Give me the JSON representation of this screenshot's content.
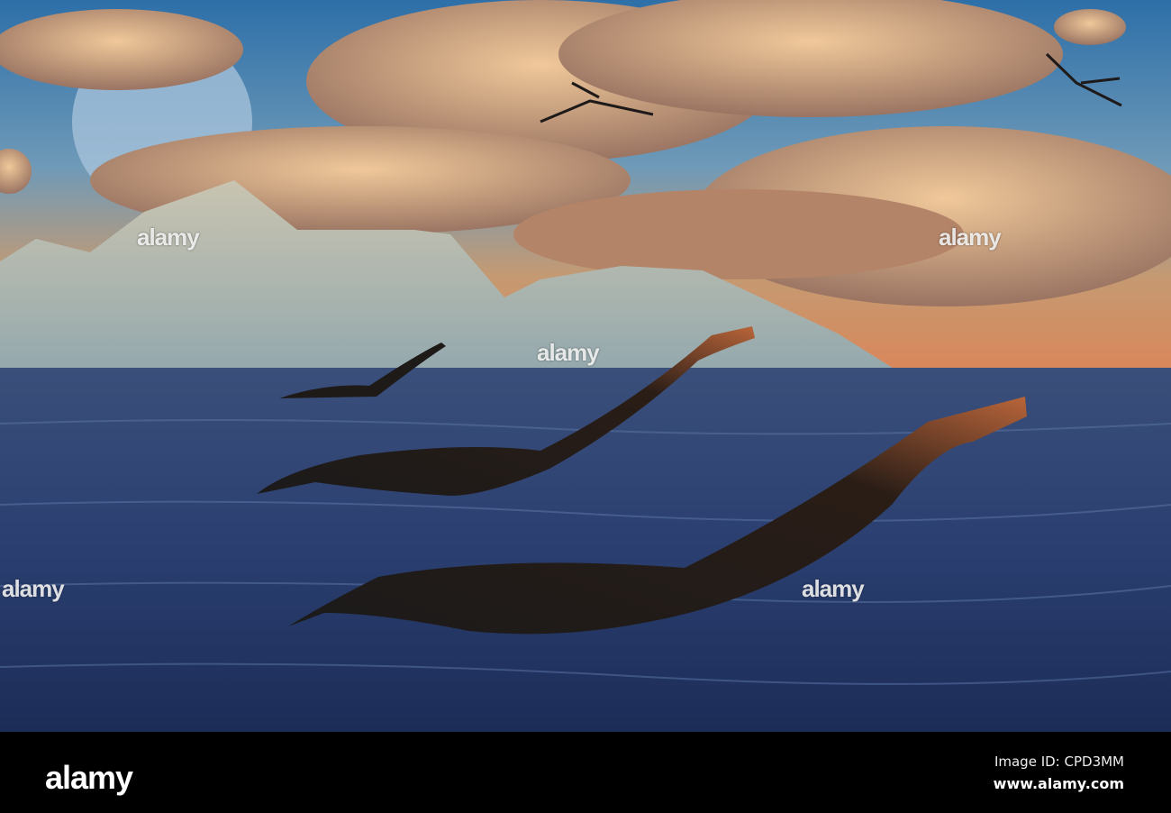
{
  "watermark": {
    "text": "alamy",
    "dot_glyph": "a"
  },
  "footer": {
    "logo": "alamy",
    "image_id": "Image ID: CPD3MM",
    "website": "www.alamy.com"
  }
}
